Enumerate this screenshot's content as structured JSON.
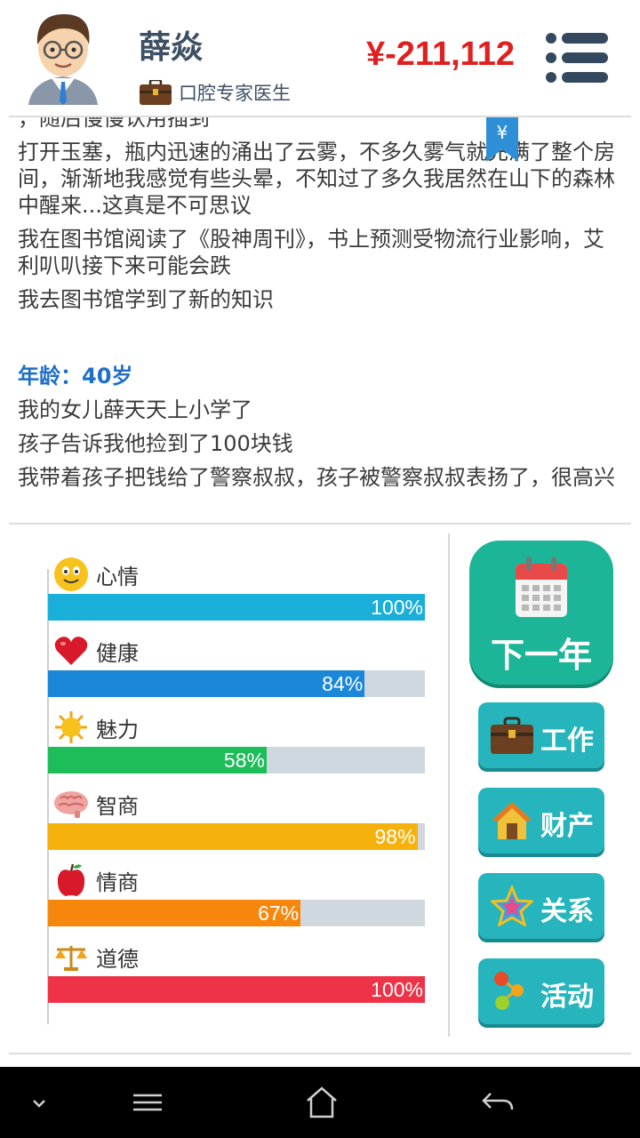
{
  "header": {
    "name": "薛焱",
    "job": "口腔专家医生",
    "money": "¥-211,112"
  },
  "log": {
    "cut_top": "，随后慢慢认用插到",
    "lines": [
      "打开玉塞，瓶内迅速的涌出了云雾，不多久雾气就充满了整个房间，渐渐地我感觉有些头晕，不知过了多久我居然在山下的森林中醒来...这真是不可思议",
      "我在图书馆阅读了《股神周刊》，书上预测受物流行业影响，艾利叭叭接下来可能会跌",
      "我去图书馆学到了新的知识"
    ],
    "age": "年龄：40岁",
    "lines2": [
      "我的女儿薛天天上小学了",
      "孩子告诉我他捡到了100块钱",
      "我带着孩子把钱给了警察叔叔，孩子被警察叔叔表扬了，很高兴"
    ],
    "yen_tag": "¥"
  },
  "stats": [
    {
      "label": "心情",
      "value": 100,
      "display": "100%",
      "color": "#1aafd8",
      "icon": "smiley-icon"
    },
    {
      "label": "健康",
      "value": 84,
      "display": "84%",
      "color": "#1a87d8",
      "icon": "heart-icon"
    },
    {
      "label": "魅力",
      "value": 58,
      "display": "58%",
      "color": "#1dbd5a",
      "icon": "sun-icon"
    },
    {
      "label": "智商",
      "value": 98,
      "display": "98%",
      "color": "#f6b20c",
      "icon": "brain-icon"
    },
    {
      "label": "情商",
      "value": 67,
      "display": "67%",
      "color": "#f7870c",
      "icon": "apple-icon"
    },
    {
      "label": "道德",
      "value": 100,
      "display": "100%",
      "color": "#ee3348",
      "icon": "scales-icon"
    }
  ],
  "actions": {
    "next_year": "下一年",
    "work": "工作",
    "property": "财产",
    "relations": "关系",
    "activity": "活动"
  },
  "colors": {
    "money": "#e02020",
    "next_year_bg": "#1db597",
    "action_bg": "#26b5bc",
    "age_text": "#1f6fc8"
  }
}
